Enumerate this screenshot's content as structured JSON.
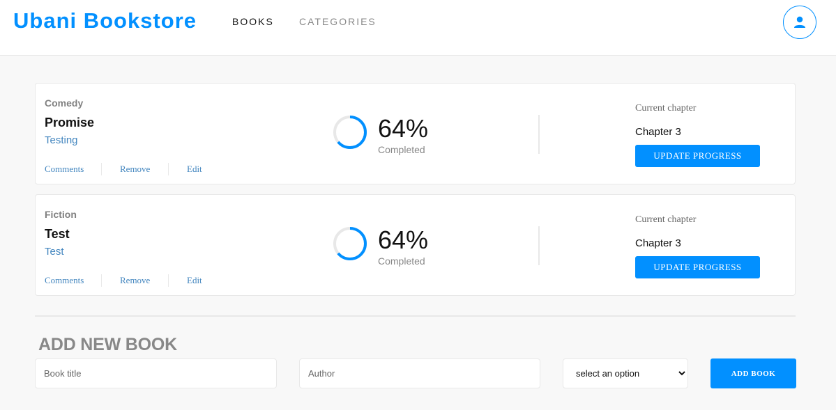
{
  "header": {
    "brand": "Ubani Bookstore",
    "nav": [
      {
        "label": "BOOKS",
        "active": true
      },
      {
        "label": "CATEGORIES",
        "active": false
      }
    ],
    "user_icon": "user-icon"
  },
  "books": [
    {
      "genre": "Comedy",
      "title": "Promise",
      "author": "Testing",
      "actions": [
        "Comments",
        "Remove",
        "Edit"
      ],
      "progress_percent": 64,
      "progress_label": "64%",
      "completed_label": "Completed",
      "chapter_label": "Current chapter",
      "chapter": "Chapter 3",
      "update_label": "UPDATE PROGRESS"
    },
    {
      "genre": "Fiction",
      "title": "Test",
      "author": "Test",
      "actions": [
        "Comments",
        "Remove",
        "Edit"
      ],
      "progress_percent": 64,
      "progress_label": "64%",
      "completed_label": "Completed",
      "chapter_label": "Current chapter",
      "chapter": "Chapter 3",
      "update_label": "UPDATE PROGRESS"
    }
  ],
  "form": {
    "title": "ADD NEW BOOK",
    "title_placeholder": "Book title",
    "author_placeholder": "Author",
    "select_value": "select an option",
    "submit_label": "ADD BOOK"
  },
  "colors": {
    "accent": "#0290ff",
    "link": "#4386bf",
    "muted": "#888888"
  }
}
